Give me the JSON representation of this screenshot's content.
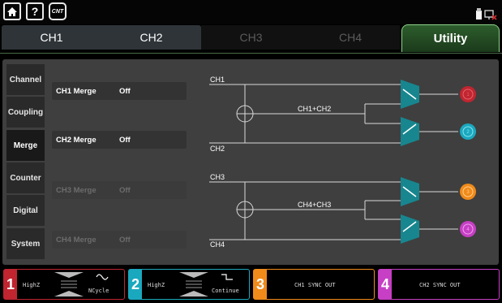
{
  "toolbar": {
    "home_icon": "home-icon",
    "help_label": "?",
    "cnt_label": "CNT"
  },
  "tabs": [
    {
      "label": "CH1",
      "state": "active"
    },
    {
      "label": "CH2",
      "state": "active"
    },
    {
      "label": "CH3",
      "state": "dim"
    },
    {
      "label": "CH4",
      "state": "dim"
    },
    {
      "label": "Utility",
      "state": "selected"
    }
  ],
  "sidebar": {
    "items": [
      {
        "label": "Channel"
      },
      {
        "label": "Coupling"
      },
      {
        "label": "Merge",
        "selected": true
      },
      {
        "label": "Counter"
      },
      {
        "label": "Digital"
      },
      {
        "label": "System"
      }
    ]
  },
  "merge": {
    "rows": [
      {
        "label": "CH1 Merge",
        "value": "Off",
        "enabled": true
      },
      {
        "label": "CH2 Merge",
        "value": "Off",
        "enabled": true
      },
      {
        "label": "CH3 Merge",
        "value": "Off",
        "enabled": false
      },
      {
        "label": "CH4 Merge",
        "value": "Off",
        "enabled": false
      }
    ]
  },
  "diagram": {
    "ch1": "CH1",
    "ch2": "CH2",
    "ch3": "CH3",
    "ch4": "CH4",
    "sum12": "CH1+CH2",
    "sum34": "CH4+CH3",
    "outputs": [
      "1",
      "2",
      "3",
      "4"
    ]
  },
  "status": {
    "channels": [
      {
        "num": "1",
        "load": "HighZ",
        "mode": "NCycle"
      },
      {
        "num": "2",
        "load": "HighZ",
        "mode": "Continue"
      },
      {
        "num": "3",
        "text": "CH1 SYNC OUT"
      },
      {
        "num": "4",
        "text": "CH2 SYNC OUT"
      }
    ]
  },
  "colors": {
    "ch1": "#c02530",
    "ch2": "#1aa8bf",
    "ch3": "#f08a1a",
    "ch4": "#c63fc4",
    "utility": "#8fd18a",
    "switch": "#17868f"
  }
}
